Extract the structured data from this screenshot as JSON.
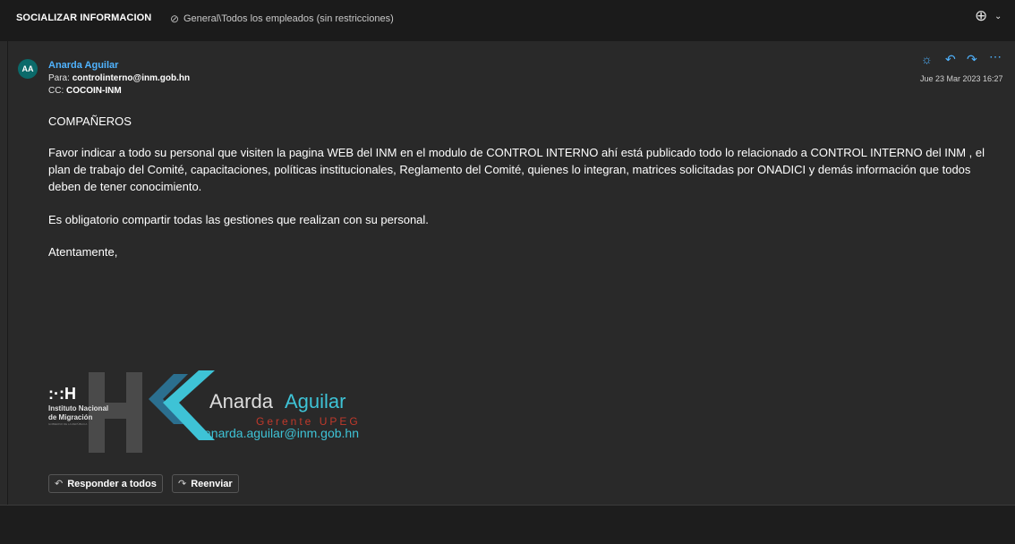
{
  "header": {
    "subject": "SOCIALIZAR INFORMACION",
    "tag_icon": "tag-icon",
    "tag": "General\\Todos los empleados (sin restricciones)",
    "zoom_icon": "zoom-icon",
    "caret": "⌄"
  },
  "message": {
    "avatar_initials": "AA",
    "avatar_color": "#0b6a6a",
    "sender": "Anarda Aguilar",
    "to_label": "Para:",
    "to": "controlinterno@inm.gob.hn",
    "cc_label": "CC:",
    "cc": "COCOIN-INM",
    "date": "Jue 23 Mar 2023 16:27",
    "accent_color": "#4fb3ff",
    "greeting": "COMPAÑEROS",
    "paragraph1": "Favor indicar a todo su personal que visiten la pagina WEB del INM en el modulo de CONTROL INTERNO ahí está publicado todo lo relacionado a CONTROL INTERNO del INM , el plan de trabajo del Comité, capacitaciones, políticas institucionales, Reglamento del Comité, quienes lo integran, matrices solicitadas por ONADICI  y demás información que todos deben de tener conocimiento.",
    "paragraph2": "Es obligatorio compartir todas las gestiones que realizan con su personal.",
    "closing": "Atentamente,"
  },
  "signature": {
    "logo_mark": ":·:H",
    "org_line1": "Instituto Nacional",
    "org_line2": "de Migración",
    "org_line3": "GOBIERNO DE LA REPÚBLICA",
    "name_first": "Anarda",
    "name_last": "Aguilar",
    "title": "Gerente UPEG",
    "email": "anarda.aguilar@inm.gob.hn",
    "accent_red": "#c0392b",
    "accent_teal": "#3ec3d6"
  },
  "footer_actions": {
    "reply_all": "Responder a todos",
    "forward": "Reenviar"
  }
}
